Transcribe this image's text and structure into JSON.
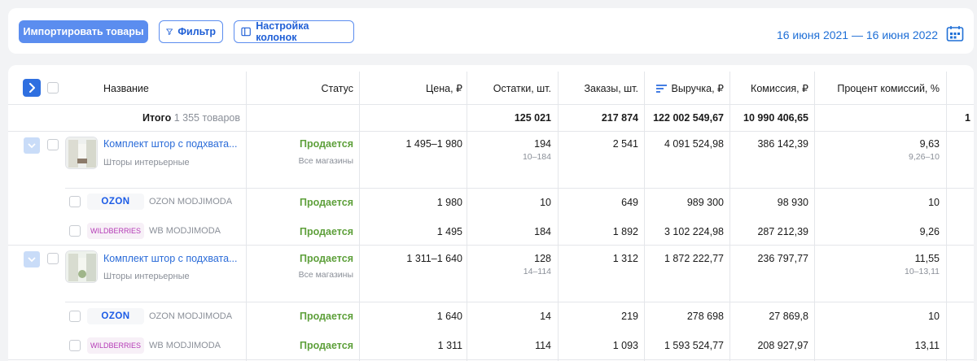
{
  "toolbar": {
    "import_label": "Импортировать товары",
    "filter_label": "Фильтр",
    "columns_label": "Настройка колонок",
    "date_range": "16 июня 2021 — 16 июня 2022"
  },
  "columns": {
    "name": "Название",
    "status": "Статус",
    "price": "Цена, ₽",
    "stock": "Остатки, шт.",
    "orders": "Заказы, шт.",
    "revenue": "Выручка, ₽",
    "commission": "Комиссия, ₽",
    "commission_pct": "Процент комиссий, %"
  },
  "total": {
    "label": "Итого",
    "count": "1 355 товаров",
    "stock": "125 021",
    "orders": "217 874",
    "revenue": "122 002 549,67",
    "commission": "10 990 406,65",
    "commission_pct": "1"
  },
  "products": [
    {
      "title": "Комплект штор с подхвата...",
      "category": "Шторы интерьерные",
      "status": "Продается",
      "status_sub": "Все магазины",
      "price": "1 495–1 980",
      "stock": "194",
      "stock_range": "10–184",
      "orders": "2 541",
      "revenue": "4 091 524,98",
      "commission": "386 142,39",
      "commission_pct": "9,63",
      "commission_pct_range": "9,26–10",
      "shops": [
        {
          "logo": "OZON",
          "name": "OZON MODJIMODA",
          "status": "Продается",
          "price": "1 980",
          "stock": "10",
          "orders": "649",
          "revenue": "989 300",
          "commission": "98 930",
          "commission_pct": "10"
        },
        {
          "logo": "WILDBERRIES",
          "name": "WB MODJIMODA",
          "status": "Продается",
          "price": "1 495",
          "stock": "184",
          "orders": "1 892",
          "revenue": "3 102 224,98",
          "commission": "287 212,39",
          "commission_pct": "9,26"
        }
      ]
    },
    {
      "title": "Комплект штор с подхвата...",
      "category": "Шторы интерьерные",
      "status": "Продается",
      "status_sub": "Все магазины",
      "price": "1 311–1 640",
      "stock": "128",
      "stock_range": "14–114",
      "orders": "1 312",
      "revenue": "1 872 222,77",
      "commission": "236 797,77",
      "commission_pct": "11,55",
      "commission_pct_range": "10–13,11",
      "shops": [
        {
          "logo": "OZON",
          "name": "OZON MODJIMODA",
          "status": "Продается",
          "price": "1 640",
          "stock": "14",
          "orders": "219",
          "revenue": "278 698",
          "commission": "27 869,8",
          "commission_pct": "10"
        },
        {
          "logo": "WILDBERRIES",
          "name": "WB MODJIMODA",
          "status": "Продается",
          "price": "1 311",
          "stock": "114",
          "orders": "1 093",
          "revenue": "1 593 524,77",
          "commission": "208 927,97",
          "commission_pct": "13,11"
        }
      ]
    }
  ],
  "icons": {
    "filter": "filter-icon",
    "columns": "columns-icon",
    "calendar": "calendar-icon",
    "expand": "chevron-right-icon",
    "sort": "sort-icon"
  },
  "colors": {
    "accent": "#2f6fe0",
    "status_green": "#5ea03b",
    "link": "#2a6bd8"
  }
}
